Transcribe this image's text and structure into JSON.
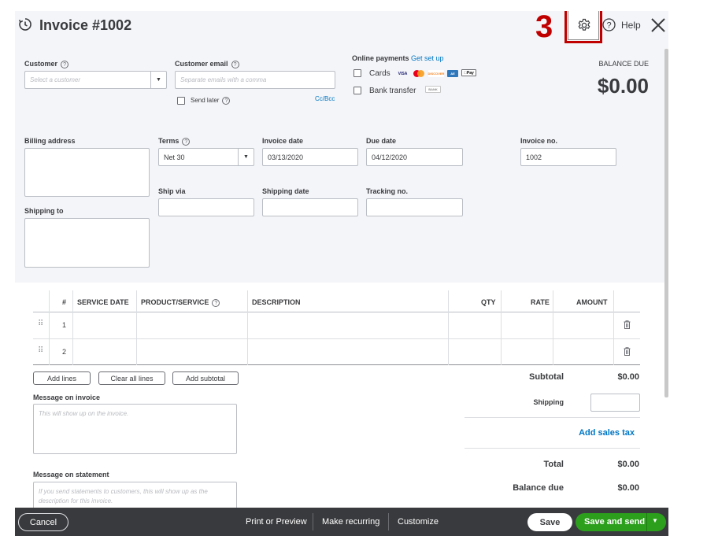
{
  "header": {
    "title": "Invoice #1002",
    "step_marker": "3",
    "help_label": "Help"
  },
  "customer": {
    "label": "Customer",
    "placeholder": "Select a customer"
  },
  "customer_email": {
    "label": "Customer email",
    "placeholder": "Separate emails with a comma",
    "send_later_label": "Send later",
    "cc_bcc_label": "Cc/Bcc"
  },
  "online_payments": {
    "label": "Online payments",
    "get_set_up": "Get set up",
    "cards_label": "Cards",
    "bank_transfer_label": "Bank transfer",
    "card_logos": [
      "VISA",
      "MC",
      "DISCOVER",
      "AMEX",
      "Pay"
    ],
    "bank_logo": "BANK"
  },
  "balance": {
    "label": "BALANCE DUE",
    "amount": "$0.00"
  },
  "billing_address": {
    "label": "Billing address"
  },
  "shipping_to": {
    "label": "Shipping to"
  },
  "terms": {
    "label": "Terms",
    "value": "Net 30"
  },
  "invoice_date": {
    "label": "Invoice date",
    "value": "03/13/2020"
  },
  "due_date": {
    "label": "Due date",
    "value": "04/12/2020"
  },
  "invoice_no": {
    "label": "Invoice no.",
    "value": "1002"
  },
  "ship_via": {
    "label": "Ship via"
  },
  "shipping_date": {
    "label": "Shipping date"
  },
  "tracking_no": {
    "label": "Tracking no."
  },
  "table": {
    "columns": {
      "num": "#",
      "service_date": "SERVICE DATE",
      "product_service": "PRODUCT/SERVICE",
      "description": "DESCRIPTION",
      "qty": "QTY",
      "rate": "RATE",
      "amount": "AMOUNT"
    },
    "rows": [
      {
        "num": "1"
      },
      {
        "num": "2"
      }
    ]
  },
  "line_buttons": {
    "add_lines": "Add lines",
    "clear_all_lines": "Clear all lines",
    "add_subtotal": "Add subtotal"
  },
  "message_invoice": {
    "label": "Message on invoice",
    "placeholder": "This will show up on the invoice."
  },
  "message_statement": {
    "label": "Message on statement",
    "placeholder": "If you send statements to customers, this will show up as the description for this invoice."
  },
  "totals": {
    "subtotal_label": "Subtotal",
    "subtotal_value": "$0.00",
    "shipping_label": "Shipping",
    "add_sales_tax": "Add sales tax",
    "total_label": "Total",
    "total_value": "$0.00",
    "balance_due_label": "Balance due",
    "balance_due_value": "$0.00"
  },
  "footer": {
    "cancel": "Cancel",
    "print_preview": "Print or Preview",
    "make_recurring": "Make recurring",
    "customize": "Customize",
    "save": "Save",
    "save_and_send": "Save and send"
  },
  "colors": {
    "accent_blue": "#0077c5",
    "green": "#2ca01c",
    "footer_bg": "#393a3d",
    "highlight_red": "#c00000"
  }
}
